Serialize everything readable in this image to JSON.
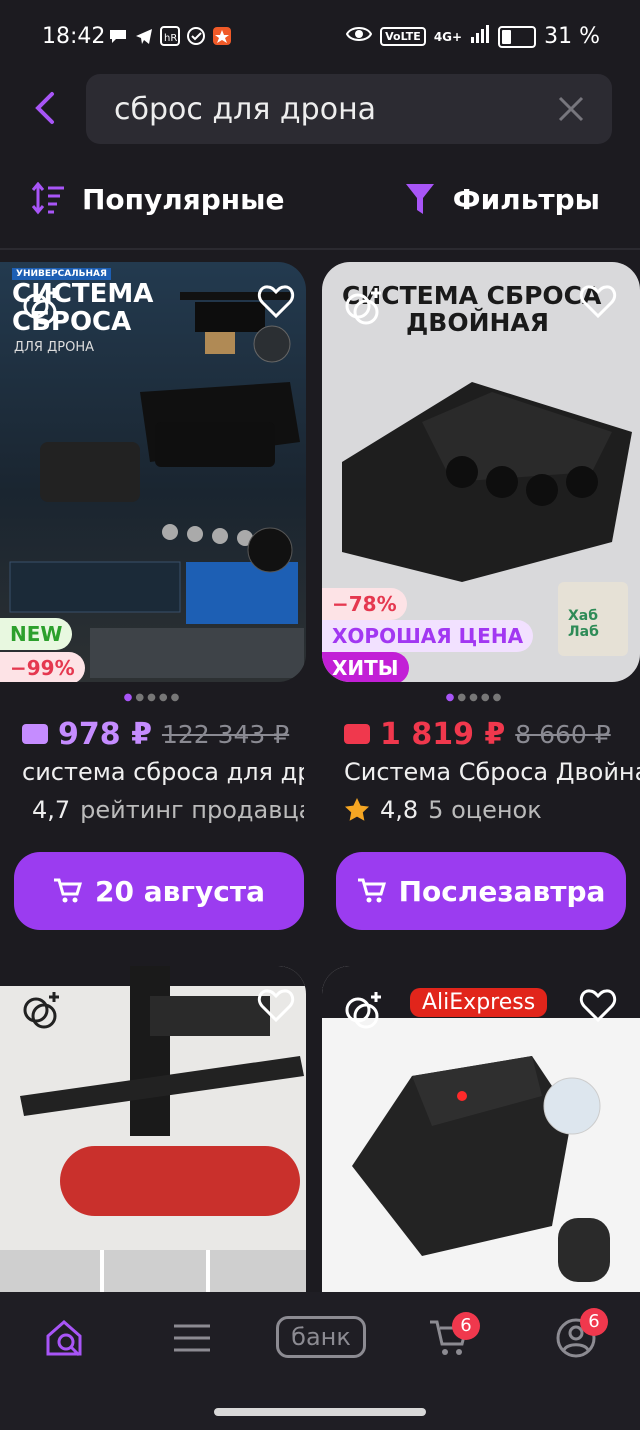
{
  "status": {
    "time": "18:42",
    "volte": "VoLTE",
    "network": "4G+",
    "battery": "31 %"
  },
  "search": {
    "query": "сброс для дрона"
  },
  "sort": {
    "label": "Популярные"
  },
  "filter": {
    "label": "Фильтры"
  },
  "colors": {
    "accent": "#9b3cf0",
    "sale_price": "#f0384d",
    "bank_price": "#c58cff"
  },
  "products": [
    {
      "image_heading": "СИСТЕМА СБРОСА",
      "image_tag": "УНИВЕРСАЛЬНАЯ",
      "image_sub": "ДЛЯ ДРОНА",
      "badges": [
        "NEW",
        "−99%"
      ],
      "price": "978 ₽",
      "old_price": "122 343 ₽",
      "title": "система сброса для дрона",
      "rating": "4,7",
      "rating_text": "рейтинг продавца",
      "rating_icon": "shop-icon",
      "cta": "20 августа"
    },
    {
      "image_heading": "СИСТЕМА СБРОСА",
      "image_sub": "ДВОЙНАЯ",
      "seller_logo": "Хаб Лаб",
      "badges": [
        "−78%",
        "ХОРОШАЯ ЦЕНА",
        "ХИТЫ"
      ],
      "price": "1 819 ₽",
      "old_price": "8 660 ₽",
      "title": "Система Сброса Двойная",
      "rating": "4,8",
      "rating_text": "5 оценок",
      "rating_icon": "star-icon",
      "cta": "Послезавтра"
    },
    {
      "store_badge": ""
    },
    {
      "store_badge": "AliExpress"
    }
  ],
  "nav": {
    "bank": "банк",
    "cart_count": "6",
    "profile_count": "6"
  }
}
